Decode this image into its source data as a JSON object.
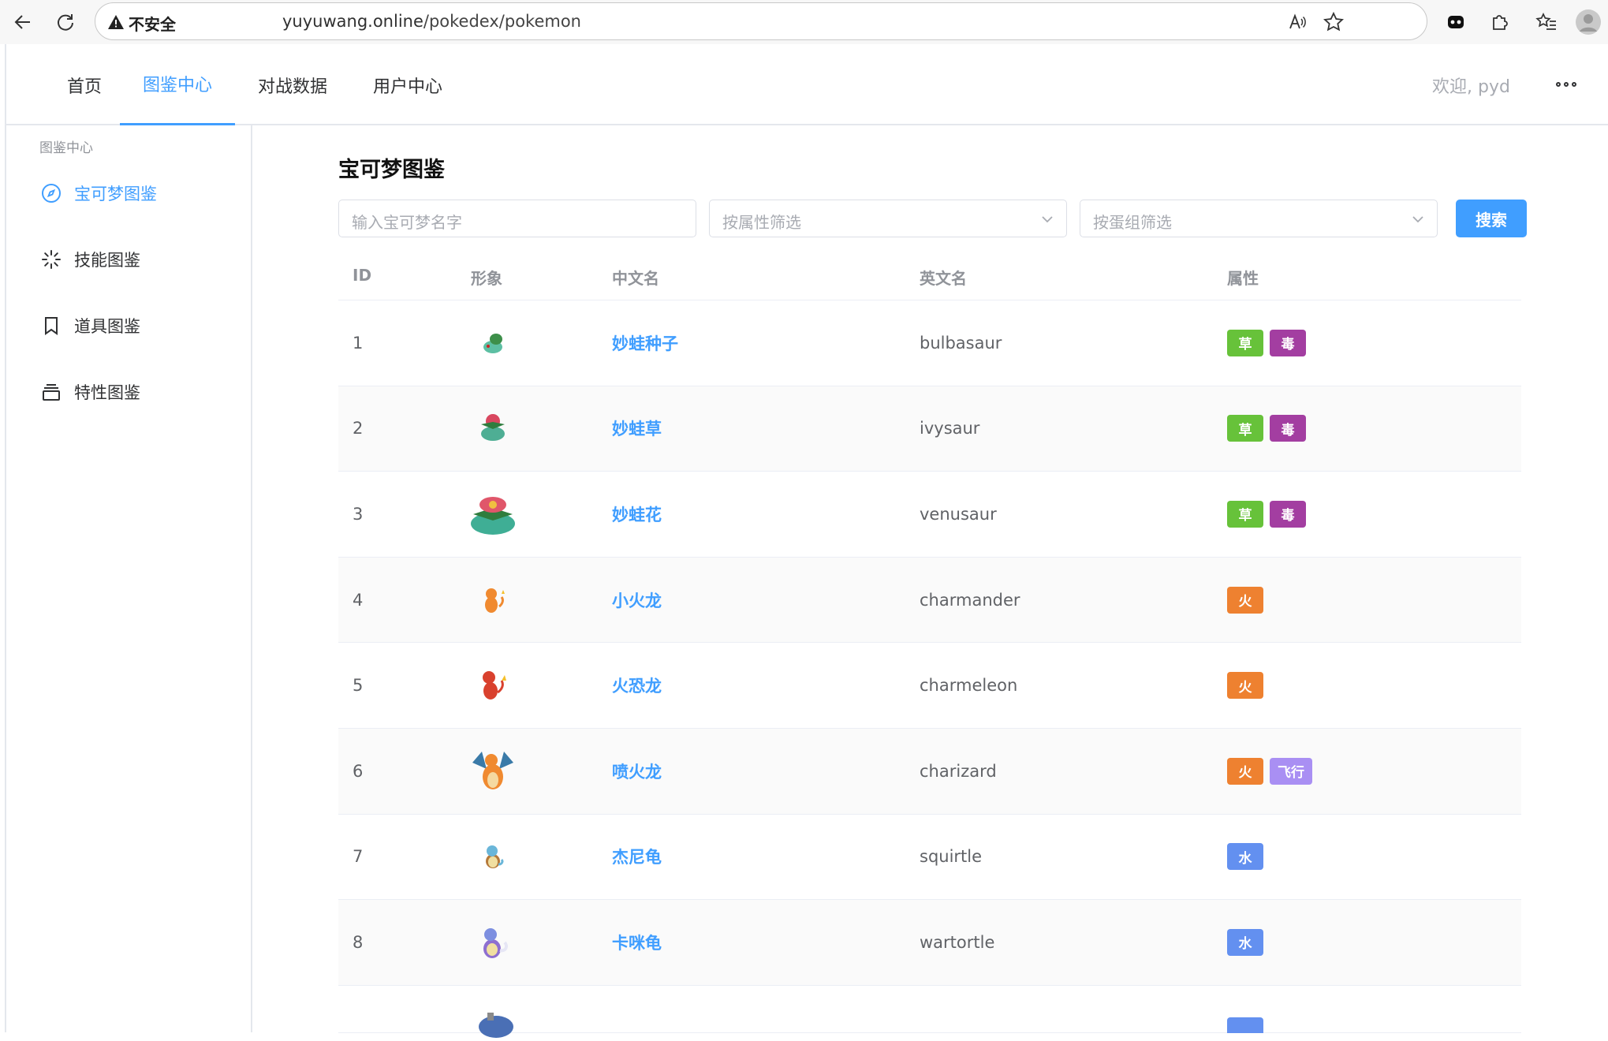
{
  "browser": {
    "insecure_label": "不安全",
    "url_host": "yuyuwang.online",
    "url_path": "/pokedex/pokemon"
  },
  "topnav": {
    "items": [
      {
        "label": "首页"
      },
      {
        "label": "图鉴中心"
      },
      {
        "label": "对战数据"
      },
      {
        "label": "用户中心"
      }
    ],
    "active_index": 1,
    "welcome": "欢迎, pyd"
  },
  "sidebar": {
    "group_title": "图鉴中心",
    "items": [
      {
        "label": "宝可梦图鉴",
        "icon": "compass-icon"
      },
      {
        "label": "技能图鉴",
        "icon": "loading-icon"
      },
      {
        "label": "道具图鉴",
        "icon": "bookmark-icon"
      },
      {
        "label": "特性图鉴",
        "icon": "box-icon"
      }
    ],
    "active_index": 0
  },
  "main": {
    "title": "宝可梦图鉴",
    "name_input": {
      "placeholder": "输入宝可梦名字",
      "value": ""
    },
    "type_select": {
      "placeholder": "按属性筛选"
    },
    "egg_select": {
      "placeholder": "按蛋组筛选"
    },
    "search_label": "搜索"
  },
  "table": {
    "headers": {
      "id": "ID",
      "image": "形象",
      "cn": "中文名",
      "en": "英文名",
      "types": "属性"
    },
    "rows": [
      {
        "id": "1",
        "cn": "妙蛙种子",
        "en": "bulbasaur",
        "types": [
          "草",
          "毒"
        ],
        "sprite": "bulbasaur-sprite"
      },
      {
        "id": "2",
        "cn": "妙蛙草",
        "en": "ivysaur",
        "types": [
          "草",
          "毒"
        ],
        "sprite": "ivysaur-sprite"
      },
      {
        "id": "3",
        "cn": "妙蛙花",
        "en": "venusaur",
        "types": [
          "草",
          "毒"
        ],
        "sprite": "venusaur-sprite"
      },
      {
        "id": "4",
        "cn": "小火龙",
        "en": "charmander",
        "types": [
          "火"
        ],
        "sprite": "charmander-sprite"
      },
      {
        "id": "5",
        "cn": "火恐龙",
        "en": "charmeleon",
        "types": [
          "火"
        ],
        "sprite": "charmeleon-sprite"
      },
      {
        "id": "6",
        "cn": "喷火龙",
        "en": "charizard",
        "types": [
          "火",
          "飞行"
        ],
        "sprite": "charizard-sprite"
      },
      {
        "id": "7",
        "cn": "杰尼龟",
        "en": "squirtle",
        "types": [
          "水"
        ],
        "sprite": "squirtle-sprite"
      },
      {
        "id": "8",
        "cn": "卡咪龟",
        "en": "wartortle",
        "types": [
          "水"
        ],
        "sprite": "wartortle-sprite"
      }
    ]
  },
  "type_colors": {
    "草": "#67c23a",
    "毒": "#a33ea1",
    "火": "#ee8130",
    "飞行": "#a98ff3",
    "水": "#6390f0"
  }
}
